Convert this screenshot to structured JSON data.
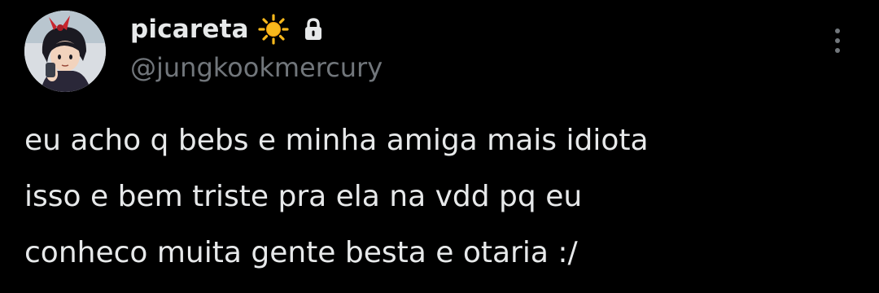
{
  "author": {
    "display_name": "picareta",
    "handle": "@jungkookmercury",
    "name_emoji": "sun-icon",
    "protected_icon": "lock-icon",
    "avatar_icon": "avatar"
  },
  "actions": {
    "more_icon": "more-vertical-icon"
  },
  "tweet": {
    "lines": [
      "eu acho q bebs e minha amiga mais idiota",
      "isso e bem triste pra ela na vdd pq eu",
      "conheco muita gente besta e otaria :/"
    ]
  },
  "colors": {
    "background": "#000000",
    "primary_text": "#e7e9ea",
    "secondary_text": "#71767b",
    "sun": "#f7b81c"
  }
}
